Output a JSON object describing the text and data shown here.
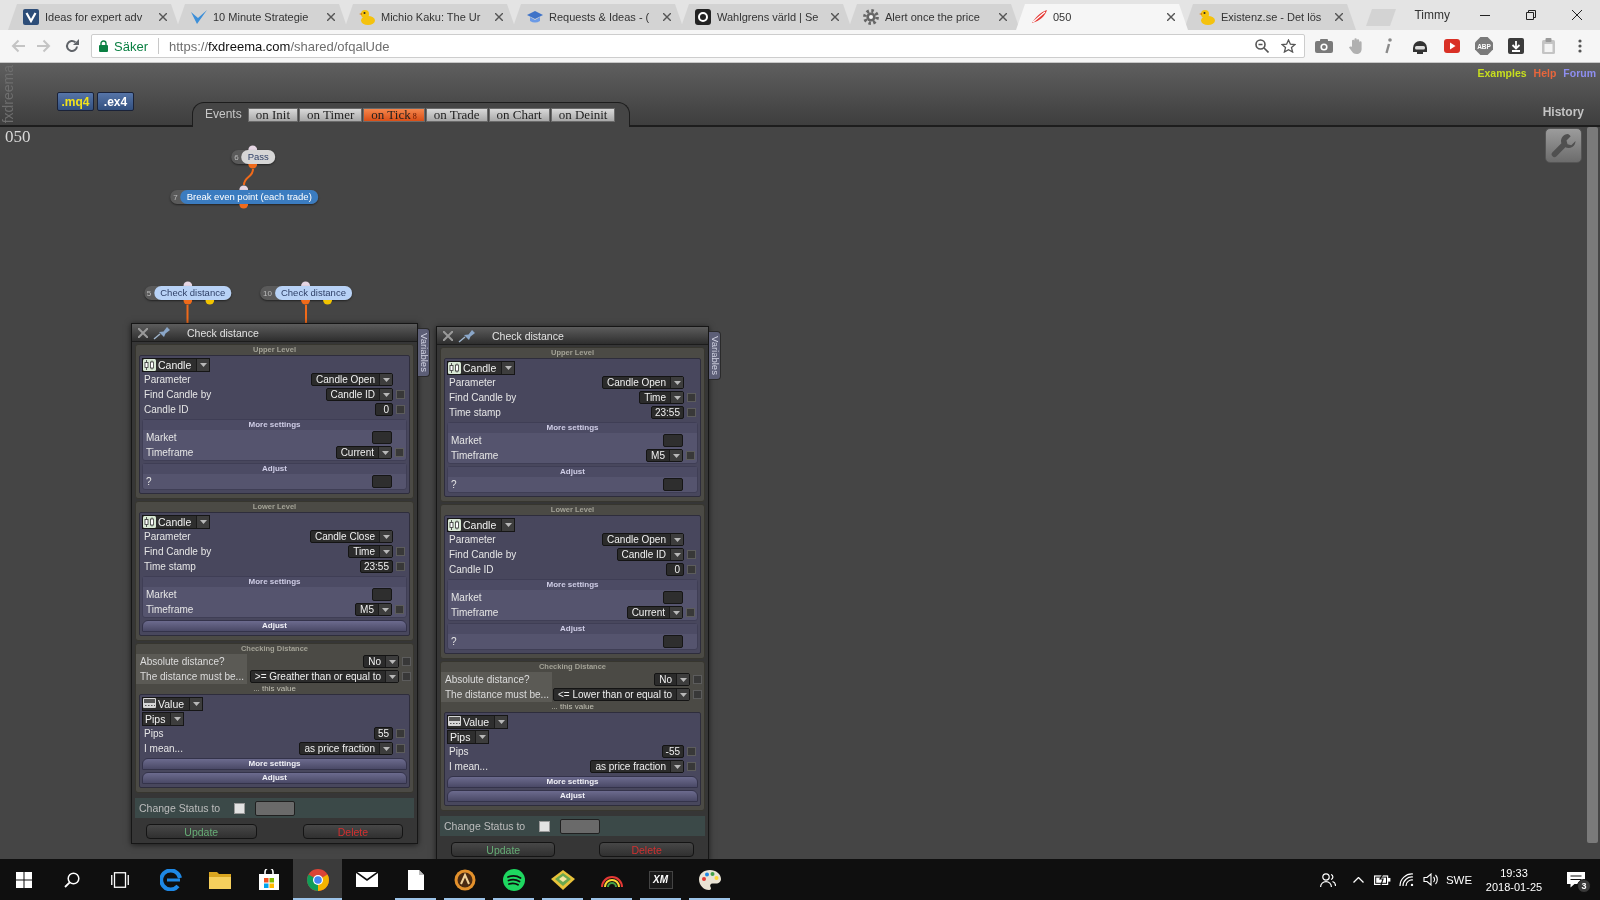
{
  "browser": {
    "tabs": [
      {
        "kind": "tile",
        "title": "Ideas for expert adv",
        "selected": false
      },
      {
        "kind": "swoosh",
        "title": "10 Minute Strategie",
        "selected": false
      },
      {
        "kind": "duck",
        "title": "Michio Kaku: The Ur",
        "selected": false
      },
      {
        "kind": "cap",
        "title": "Requests & Ideas - (",
        "selected": false
      },
      {
        "kind": "ring",
        "title": "Wahlgrens värld | Se",
        "selected": false
      },
      {
        "kind": "gear",
        "title": "Alert once the price",
        "selected": false
      },
      {
        "kind": "feather",
        "title": "050",
        "selected": true
      },
      {
        "kind": "duck",
        "title": "Existenz.se - Det lös",
        "selected": false
      }
    ],
    "profile": "Timmy",
    "nav": [
      {
        "kind": "back",
        "disabled": true
      },
      {
        "kind": "forward",
        "disabled": true
      },
      {
        "kind": "reload",
        "disabled": false
      }
    ],
    "security": "Säker",
    "url_scheme": "https://",
    "url_host": "fxdreema.com",
    "url_path": "/shared/ofqalUde",
    "extensions": [
      {
        "kind": "camera"
      },
      {
        "kind": "hand"
      },
      {
        "kind": "info"
      },
      {
        "kind": "helmet"
      },
      {
        "kind": "play"
      },
      {
        "kind": "stop",
        "label": "ABP"
      },
      {
        "kind": "download"
      },
      {
        "kind": "clipboard"
      }
    ]
  },
  "app": {
    "brand": "fxdreema",
    "exports": [
      {
        "kind": "mq4",
        "label": ".mq4"
      },
      {
        "kind": "ex4",
        "label": ".ex4"
      }
    ],
    "events_label": "Events",
    "events": [
      {
        "label": "on Init",
        "selected": false
      },
      {
        "label": "on Timer",
        "selected": false
      },
      {
        "label": "on Tick",
        "count": "8",
        "selected": true
      },
      {
        "label": "on Trade",
        "selected": false
      },
      {
        "label": "on Chart",
        "selected": false
      },
      {
        "label": "on Deinit",
        "selected": false
      }
    ],
    "links": [
      {
        "label": "Examples",
        "color": "#c8de1e"
      },
      {
        "label": "Help",
        "color": "#e8663c"
      },
      {
        "label": "Forum",
        "color": "#8e8ef0"
      }
    ],
    "history": "History",
    "project": "050"
  },
  "nodes": [
    {
      "kind": "action",
      "number": "6",
      "label": "Pass",
      "color": "#d6d6d6"
    },
    {
      "kind": "action",
      "number": "7",
      "label": "Break even point (each trade)",
      "color": "#3b7cc0"
    },
    {
      "kind": "condition",
      "number": "5",
      "label": "Check distance",
      "color": "#b8d2f6"
    },
    {
      "kind": "condition",
      "number": "10",
      "label": "Check distance",
      "color": "#b8d2f6"
    }
  ],
  "panels": [
    {
      "title": "Check distance",
      "side_tab": "Variables",
      "sections": [
        {
          "title": "Upper Level",
          "block": {
            "kind": "candle",
            "selector": "Candle",
            "rows": [
              {
                "kind": "select",
                "label": "Parameter",
                "value": "Candle Open"
              },
              {
                "kind": "select",
                "label": "Find Candle by",
                "value": "Candle ID",
                "checked": false
              },
              {
                "kind": "number",
                "label": "Candle ID",
                "value": "0",
                "checked": false
              }
            ],
            "groups": [
              {
                "title": "More settings",
                "expanded": true,
                "rows": [
                  {
                    "kind": "blank",
                    "label": "Market"
                  },
                  {
                    "kind": "select",
                    "label": "Timeframe",
                    "value": "Current",
                    "checked": false
                  }
                ]
              },
              {
                "title": "Adjust",
                "expanded": true,
                "rows": [
                  {
                    "kind": "blank",
                    "label": "?"
                  }
                ]
              }
            ]
          }
        },
        {
          "title": "Lower Level",
          "block": {
            "kind": "candle",
            "selector": "Candle",
            "rows": [
              {
                "kind": "select",
                "label": "Parameter",
                "value": "Candle Close"
              },
              {
                "kind": "select",
                "label": "Find Candle by",
                "value": "Time",
                "checked": false
              },
              {
                "kind": "number",
                "label": "Time stamp",
                "value": "23:55",
                "checked": false
              }
            ],
            "groups": [
              {
                "title": "More settings",
                "expanded": true,
                "rows": [
                  {
                    "kind": "blank",
                    "label": "Market"
                  },
                  {
                    "kind": "select",
                    "label": "Timeframe",
                    "value": "M5",
                    "checked": false
                  }
                ]
              },
              {
                "title": "Adjust",
                "expanded": false
              }
            ]
          }
        },
        {
          "title": "Checking Distance",
          "rows": [
            {
              "kind": "select",
              "label": "Absolute distance?",
              "value": "No",
              "checked": false
            },
            {
              "kind": "select",
              "label": "The distance must be...",
              "value": ">= Greather than or equal to",
              "checked": false
            }
          ],
          "note": "... this value",
          "block": {
            "kind": "value",
            "selector": "Value",
            "unit": "Pips",
            "rows": [
              {
                "kind": "number",
                "label": "Pips",
                "value": "55",
                "checked": false
              },
              {
                "kind": "select",
                "label": "I mean...",
                "value": "as price fraction",
                "checked": false
              }
            ],
            "groups": [
              {
                "title": "More settings",
                "expanded": false
              },
              {
                "title": "Adjust",
                "expanded": false
              }
            ]
          }
        }
      ],
      "status": {
        "label": "Change Status to",
        "checked": false
      },
      "buttons": [
        {
          "kind": "update",
          "label": "Update"
        },
        {
          "kind": "delete",
          "label": "Delete"
        }
      ]
    },
    {
      "title": "Check distance",
      "side_tab": "Variables",
      "sections": [
        {
          "title": "Upper Level",
          "block": {
            "kind": "candle",
            "selector": "Candle",
            "rows": [
              {
                "kind": "select",
                "label": "Parameter",
                "value": "Candle Open"
              },
              {
                "kind": "select",
                "label": "Find Candle by",
                "value": "Time",
                "checked": false
              },
              {
                "kind": "number",
                "label": "Time stamp",
                "value": "23:55",
                "checked": false
              }
            ],
            "groups": [
              {
                "title": "More settings",
                "expanded": true,
                "rows": [
                  {
                    "kind": "blank",
                    "label": "Market"
                  },
                  {
                    "kind": "select",
                    "label": "Timeframe",
                    "value": "M5",
                    "checked": false
                  }
                ]
              },
              {
                "title": "Adjust",
                "expanded": true,
                "rows": [
                  {
                    "kind": "blank",
                    "label": "?"
                  }
                ]
              }
            ]
          }
        },
        {
          "title": "Lower Level",
          "block": {
            "kind": "candle",
            "selector": "Candle",
            "rows": [
              {
                "kind": "select",
                "label": "Parameter",
                "value": "Candle Open"
              },
              {
                "kind": "select",
                "label": "Find Candle by",
                "value": "Candle ID",
                "checked": false
              },
              {
                "kind": "number",
                "label": "Candle ID",
                "value": "0",
                "checked": false
              }
            ],
            "groups": [
              {
                "title": "More settings",
                "expanded": true,
                "rows": [
                  {
                    "kind": "blank",
                    "label": "Market"
                  },
                  {
                    "kind": "select",
                    "label": "Timeframe",
                    "value": "Current",
                    "checked": false
                  }
                ]
              },
              {
                "title": "Adjust",
                "expanded": true,
                "rows": [
                  {
                    "kind": "blank",
                    "label": "?"
                  }
                ]
              }
            ]
          }
        },
        {
          "title": "Checking Distance",
          "rows": [
            {
              "kind": "select",
              "label": "Absolute distance?",
              "value": "No",
              "checked": false
            },
            {
              "kind": "select",
              "label": "The distance must be...",
              "value": "<= Lower than or equal to",
              "checked": false
            }
          ],
          "note": "... this value",
          "block": {
            "kind": "value",
            "selector": "Value",
            "unit": "Pips",
            "rows": [
              {
                "kind": "number",
                "label": "Pips",
                "value": "-55",
                "checked": false
              },
              {
                "kind": "select",
                "label": "I mean...",
                "value": "as price fraction",
                "checked": false
              }
            ],
            "groups": [
              {
                "title": "More settings",
                "expanded": false
              },
              {
                "title": "Adjust",
                "expanded": false
              }
            ]
          }
        }
      ],
      "status": {
        "label": "Change Status to",
        "checked": false
      },
      "buttons": [
        {
          "kind": "update",
          "label": "Update"
        },
        {
          "kind": "delete",
          "label": "Delete"
        }
      ]
    }
  ],
  "taskbar": {
    "apps": [
      {
        "kind": "ring",
        "running": false,
        "selected": false
      },
      {
        "kind": "folder",
        "running": false,
        "selected": false
      },
      {
        "kind": "bag",
        "running": false,
        "selected": false
      },
      {
        "kind": "wheel",
        "running": true,
        "selected": true
      },
      {
        "kind": "envelope",
        "running": false,
        "selected": false
      },
      {
        "kind": "page",
        "running": true,
        "selected": false
      },
      {
        "kind": "emblem",
        "running": true,
        "selected": false
      },
      {
        "kind": "waves",
        "running": true,
        "selected": false
      },
      {
        "kind": "diamond",
        "running": true,
        "selected": false
      },
      {
        "kind": "arcs",
        "running": true,
        "selected": false
      },
      {
        "kind": "tile",
        "label": "XM",
        "running": true,
        "selected": false
      },
      {
        "kind": "palette",
        "running": true,
        "selected": false
      }
    ],
    "language": "SWE",
    "time": "19:33",
    "date": "2018-01-25",
    "notifications": "3"
  }
}
